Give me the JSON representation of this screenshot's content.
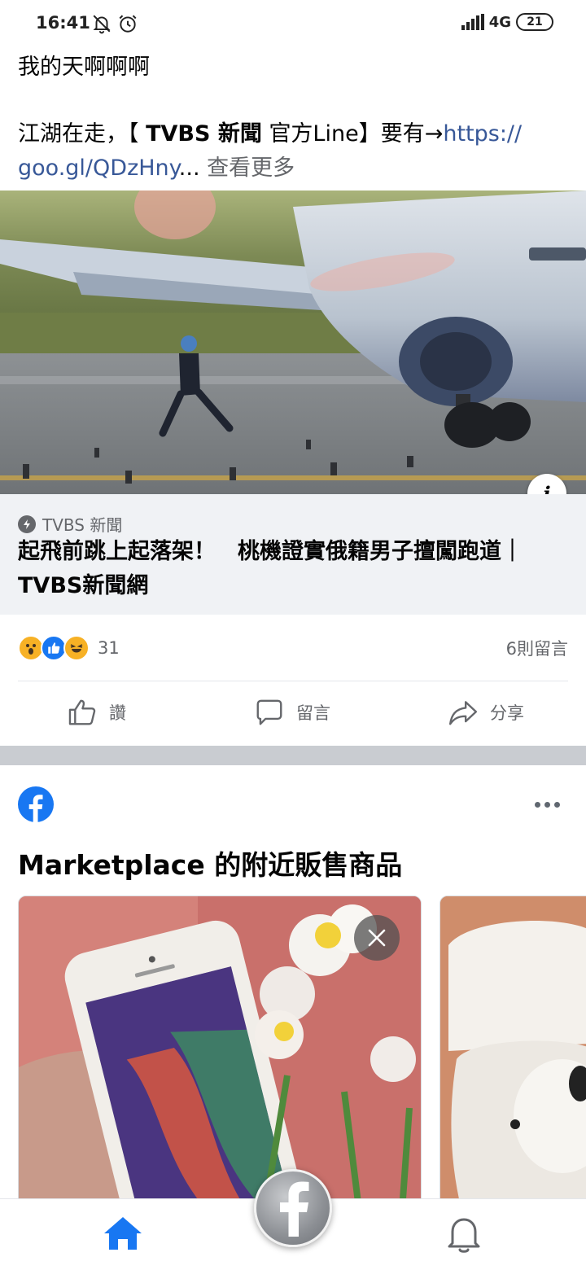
{
  "status_bar": {
    "time": "16:41",
    "network": "4G",
    "battery": "21"
  },
  "post": {
    "line1": "我的天啊啊啊",
    "line2_prefix": "江湖在走，【",
    "line2_brand": "TVBS 新聞",
    "line2_suffix": "官方Line】要有→",
    "link_part1": "https://",
    "link_part2": "goo.gl/QDzHny",
    "ellipsis": "...",
    "see_more": "查看更多"
  },
  "link_card": {
    "source": "TVBS 新聞",
    "title": "起飛前跳上起落架！　桃機證實俄籍男子擅闖跑道｜TVBS新聞網"
  },
  "reactions": {
    "count": "31",
    "comments": "6則留言"
  },
  "actions": {
    "like": "讚",
    "comment": "留言",
    "share": "分享"
  },
  "marketplace": {
    "title": "Marketplace 的附近販售商品"
  },
  "colors": {
    "facebook_blue": "#1877f2",
    "link_color": "#385898",
    "secondary_text": "#65676b"
  }
}
